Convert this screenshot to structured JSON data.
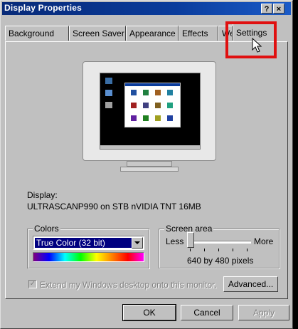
{
  "window": {
    "title": "Display Properties",
    "help_btn": "?",
    "close_btn": "×"
  },
  "tabs": [
    "Background",
    "Screen Saver",
    "Appearance",
    "Effects",
    "Web",
    "Settings"
  ],
  "active_tab": "Settings",
  "display": {
    "label": "Display:",
    "value": "ULTRASCANP990 on STB nVIDIA TNT 16MB"
  },
  "colors": {
    "caption": "Colors",
    "selected": "True Color (32 bit)"
  },
  "screen_area": {
    "caption": "Screen area",
    "less": "Less",
    "more": "More",
    "resolution": "640 by 480 pixels",
    "level": 0
  },
  "extend_checkbox": {
    "label": "Extend my Windows desktop onto this monitor.",
    "checked": true,
    "disabled": true
  },
  "buttons": {
    "advanced": "Advanced...",
    "ok": "OK",
    "cancel": "Cancel",
    "apply": "Apply"
  },
  "colors_theme": {
    "title_bar": "#0a3c9c",
    "highlight": "#e01010",
    "face": "#c0c0c0"
  }
}
